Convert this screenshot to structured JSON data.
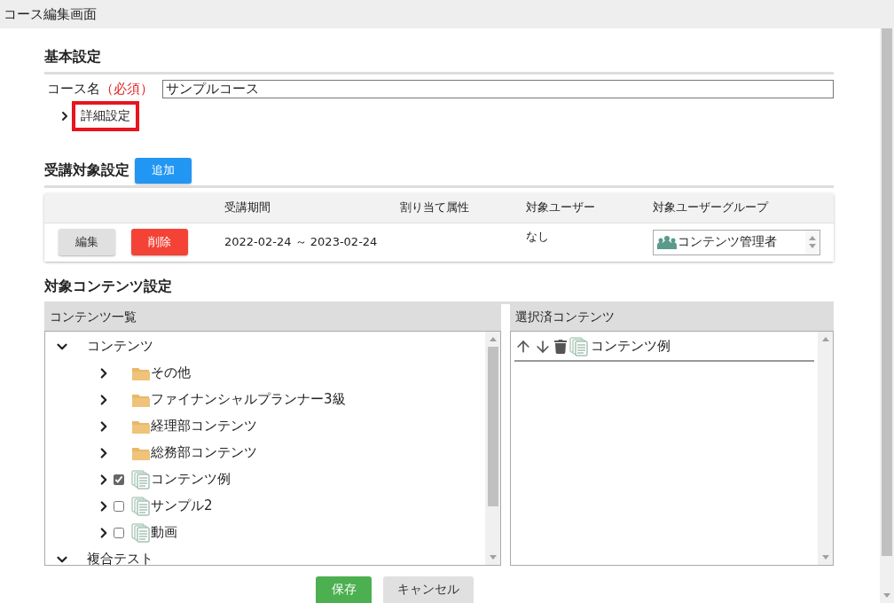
{
  "window": {
    "title": "コース編集画面"
  },
  "basic_settings": {
    "heading": "基本設定",
    "course_name": {
      "label": "コース名",
      "required": "（必須）",
      "value": "サンプルコース"
    },
    "details_toggle": {
      "label": "詳細設定",
      "expanded": false,
      "highlighted": true
    }
  },
  "audience_settings": {
    "heading": "受講対象設定",
    "add_button": "追加",
    "table": {
      "columns": [
        "受講期間",
        "割り当て属性",
        "対象ユーザー",
        "対象ユーザーグループ"
      ],
      "rows": [
        {
          "edit_button": "編集",
          "delete_button": "削除",
          "period": "2022-02-24 ～ 2023-02-24",
          "attributes": "",
          "users": "なし",
          "groups": [
            "コンテンツ管理者"
          ]
        }
      ]
    }
  },
  "content_settings": {
    "heading": "対象コンテンツ設定",
    "content_list": {
      "title": "コンテンツ一覧",
      "tree": [
        {
          "kind": "category",
          "label": "コンテンツ",
          "expanded": true,
          "children": [
            {
              "kind": "folder",
              "label": "その他",
              "expanded": false
            },
            {
              "kind": "folder",
              "label": "ファイナンシャルプランナー3級",
              "expanded": false
            },
            {
              "kind": "folder",
              "label": "経理部コンテンツ",
              "expanded": false
            },
            {
              "kind": "folder",
              "label": "総務部コンテンツ",
              "expanded": false
            },
            {
              "kind": "content",
              "label": "コンテンツ例",
              "expanded": false,
              "checked": true
            },
            {
              "kind": "content",
              "label": "サンプル2",
              "expanded": false,
              "checked": false
            },
            {
              "kind": "content",
              "label": "動画",
              "expanded": false,
              "checked": false
            }
          ]
        },
        {
          "kind": "category",
          "label": "複合テスト",
          "expanded": true
        }
      ]
    },
    "selected_list": {
      "title": "選択済コンテンツ",
      "items": [
        {
          "label": "コンテンツ例"
        }
      ]
    }
  },
  "buttons": [
    {
      "kind": "primary",
      "label": "保存"
    },
    {
      "kind": "secondary",
      "label": "キャンセル"
    }
  ]
}
